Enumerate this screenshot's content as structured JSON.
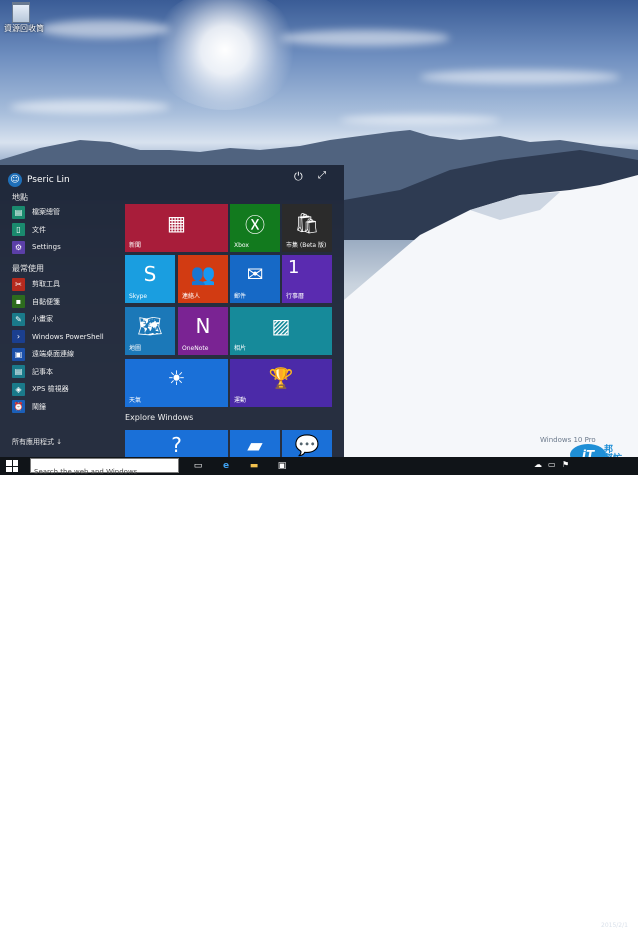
{
  "desktop": {
    "recycle_bin_label": "資源回收筒",
    "watermark": "Windows 10 Pro",
    "date": "2015/2/1",
    "ithelp_logo": "iT",
    "ithelp_text": "邦\n幫忙"
  },
  "start_menu": {
    "user_name": "Pseric Lin",
    "places_header": "地點",
    "places": [
      {
        "label": "檔案總管",
        "icon": "folder-icon",
        "color": "#1a8a6e"
      },
      {
        "label": "文件",
        "icon": "document-icon",
        "color": "#1a8a6e"
      },
      {
        "label": "Settings",
        "icon": "gear-icon",
        "color": "#5b3fa8"
      }
    ],
    "most_used_header": "最常使用",
    "most_used": [
      {
        "label": "剪取工具",
        "icon": "scissors-icon",
        "color": "#b52a1e"
      },
      {
        "label": "自黏便箋",
        "icon": "note-icon",
        "color": "#2d6b1e"
      },
      {
        "label": "小畫家",
        "icon": "paint-icon",
        "color": "#1a7a8a"
      },
      {
        "label": "Windows PowerShell",
        "icon": "powershell-icon",
        "color": "#1b3f8f"
      },
      {
        "label": "遠端桌面連線",
        "icon": "remote-desktop-icon",
        "color": "#1b4fa8"
      },
      {
        "label": "記事本",
        "icon": "notepad-icon",
        "color": "#1a7a8a"
      },
      {
        "label": "XPS 檢視器",
        "icon": "xps-icon",
        "color": "#1a7a8a"
      },
      {
        "label": "鬧鐘",
        "icon": "alarm-icon",
        "color": "#1b5fb8"
      }
    ],
    "all_apps": "所有應用程式 ↓",
    "explore_header": "Explore Windows",
    "tiles": [
      {
        "label": "新聞",
        "icon": "news-icon",
        "color": "#a81d3a"
      },
      {
        "label": "Xbox",
        "icon": "xbox-icon",
        "color": "#127a1e"
      },
      {
        "label": "市集 (Beta 版)",
        "icon": "store-icon",
        "color": "#2b2b2b"
      },
      {
        "label": "Skype",
        "icon": "skype-icon",
        "color": "#1a9ee0"
      },
      {
        "label": "連絡人",
        "icon": "people-icon",
        "color": "#d23b12"
      },
      {
        "label": "郵件",
        "icon": "mail-icon",
        "color": "#1669c6"
      },
      {
        "label": "行事曆",
        "icon": "calendar-icon",
        "color": "#5a2bb0",
        "badge": "1"
      },
      {
        "label": "地圖",
        "icon": "map-icon",
        "color": "#1b78b8"
      },
      {
        "label": "OneNote",
        "icon": "onenote-icon",
        "color": "#7a2393"
      },
      {
        "label": "相片",
        "icon": "photos-icon",
        "color": "#168a9a"
      },
      {
        "label": "天氣",
        "icon": "weather-icon",
        "color": "#1a70d8"
      },
      {
        "label": "運動",
        "icon": "trophy-icon",
        "color": "#4b2aa8"
      },
      {
        "label": "",
        "icon": "help-icon",
        "color": "#1a70d8"
      },
      {
        "label": "",
        "icon": "windows-feedback-icon",
        "color": "#1a70d8"
      },
      {
        "label": "",
        "icon": "people-feedback-icon",
        "color": "#1a70d8"
      }
    ]
  },
  "taskbar": {
    "search_placeholder": "Search the web and Windows",
    "apps": [
      "task-view-icon",
      "edge-icon",
      "file-explorer-icon",
      "store-icon"
    ]
  }
}
